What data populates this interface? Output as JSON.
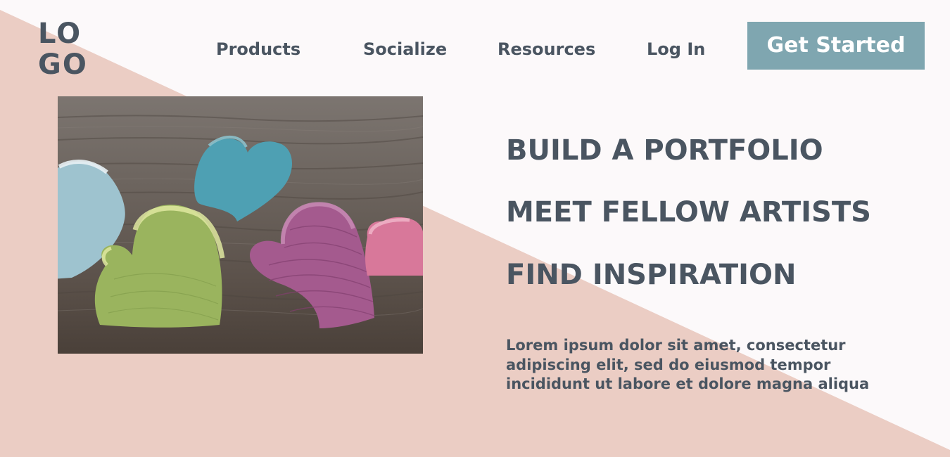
{
  "header": {
    "logo_text": "LO\nGO",
    "nav": [
      {
        "label": "Products"
      },
      {
        "label": "Socialize"
      },
      {
        "label": "Resources"
      },
      {
        "label": "Log In"
      }
    ],
    "cta_label": "Get Started"
  },
  "hero": {
    "image_description": "wooden-hearts-photo",
    "headlines": [
      "BUILD A PORTFOLIO",
      "MEET FELLOW ARTISTS",
      "FIND INSPIRATION"
    ],
    "body": "Lorem ipsum dolor sit amet, consectetur adipiscing elit, sed do eiusmod tempor incididunt ut labore et dolore magna aliqua"
  },
  "colors": {
    "background": "#fcf9fa",
    "accent_triangle": "#ebcdc4",
    "text": "#4a5561",
    "cta_bg": "#7fa6b0",
    "cta_text": "#ffffff"
  }
}
